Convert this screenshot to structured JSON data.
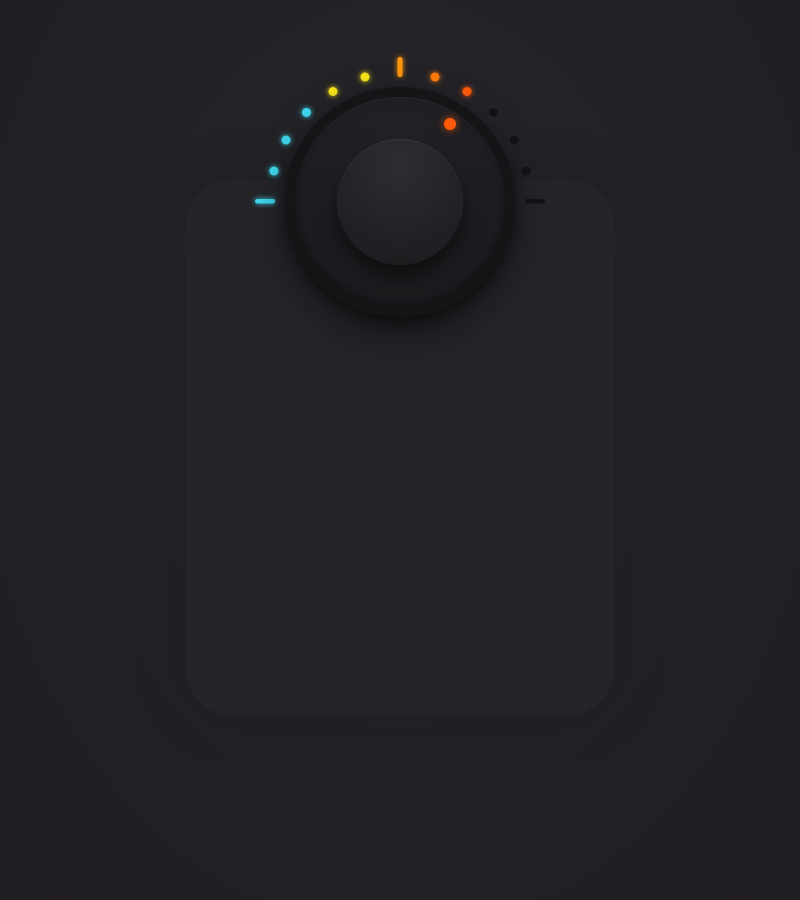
{
  "knob": {
    "level": 0.6,
    "tick_count": 11,
    "active_ticks": 7,
    "colors": {
      "cyan": "#3fd8ef",
      "yellow": "#f4e21a",
      "amber": "#ff9a0a",
      "orange": "#ff5a0a",
      "inactive": "#131215",
      "indicator": "#ff5a0a"
    },
    "tick_colors": [
      "#3fd8ef",
      "#3fd8ef",
      "#3fd8ef",
      "#3fd8ef",
      "#f4e21a",
      "#f4e21a",
      "#ff9a0a",
      "#ff7a0a",
      "#ff5a0a",
      "#131215",
      "#131215",
      "#131215",
      "#131215"
    ]
  }
}
